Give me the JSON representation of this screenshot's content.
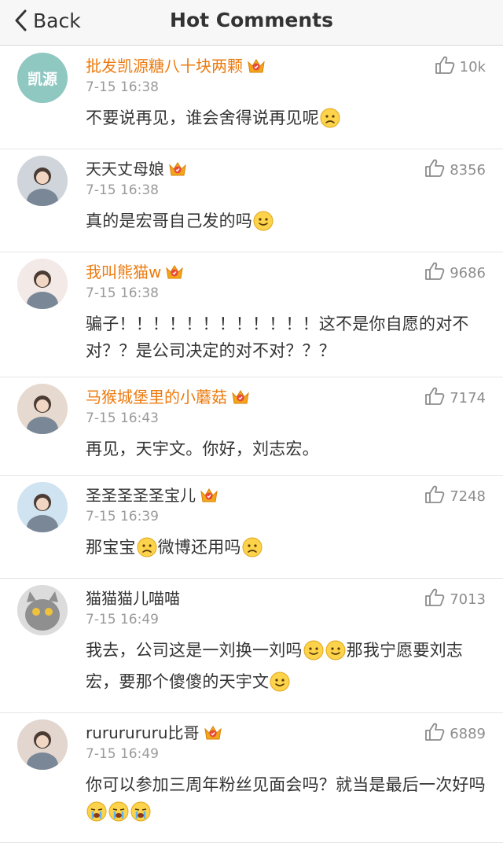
{
  "nav": {
    "back_label": "Back",
    "title": "Hot Comments"
  },
  "comments": [
    {
      "username": "批发凯源糖八十块两颗",
      "vip": true,
      "time": "7-15 16:38",
      "likes": "10k",
      "avatar_text": "凯源",
      "parts": [
        {
          "t": "不要说再见，谁会舍得说再见呢"
        },
        {
          "e": "sad"
        }
      ]
    },
    {
      "username": "天天丈母娘",
      "vip": false,
      "crown": true,
      "time": "7-15 16:38",
      "likes": "8356",
      "parts": [
        {
          "t": "真的是宏哥自己发的吗"
        },
        {
          "e": "smile"
        }
      ]
    },
    {
      "username": "我叫熊猫w",
      "vip": true,
      "time": "7-15 16:38",
      "likes": "9686",
      "parts": [
        {
          "t": "骗子！！！！！！！！！！！！这不是你自愿的对不对？？是公司决定的对不对？？？"
        }
      ]
    },
    {
      "username": "马猴城堡里的小蘑菇",
      "vip": true,
      "time": "7-15 16:43",
      "likes": "7174",
      "parts": [
        {
          "t": "再见，天宇文。你好，刘志宏。"
        }
      ]
    },
    {
      "username": "圣圣圣圣圣宝儿",
      "vip": false,
      "crown": true,
      "time": "7-15 16:39",
      "likes": "7248",
      "parts": [
        {
          "t": "那宝宝"
        },
        {
          "e": "sad"
        },
        {
          "t": "微博还用吗"
        },
        {
          "e": "sad"
        }
      ]
    },
    {
      "username": "猫猫猫儿喵喵",
      "vip": false,
      "crown": false,
      "time": "7-15 16:49",
      "likes": "7013",
      "parts": [
        {
          "t": "我去，公司这是一刘换一刘吗"
        },
        {
          "e": "smile"
        },
        {
          "e": "smile"
        },
        {
          "t": "那我宁愿要刘志宏，要那个傻傻的天宇文"
        },
        {
          "e": "smile"
        }
      ]
    },
    {
      "username": "rururururu比哥",
      "vip": false,
      "crown": true,
      "time": "7-15 16:49",
      "likes": "6889",
      "parts": [
        {
          "t": "你可以参加三周年粉丝见面会吗？就当是最后一次好吗"
        },
        {
          "e": "cry"
        },
        {
          "e": "cry"
        },
        {
          "e": "cry"
        }
      ]
    }
  ],
  "colors": {
    "vip_name": "#ec7b10",
    "text": "#333333",
    "meta": "#9a9a9a",
    "crown": "#f2a61a"
  },
  "icons": {
    "back": "chevron-left-icon",
    "like": "thumbs-up-icon",
    "crown": "vip-crown-icon"
  }
}
